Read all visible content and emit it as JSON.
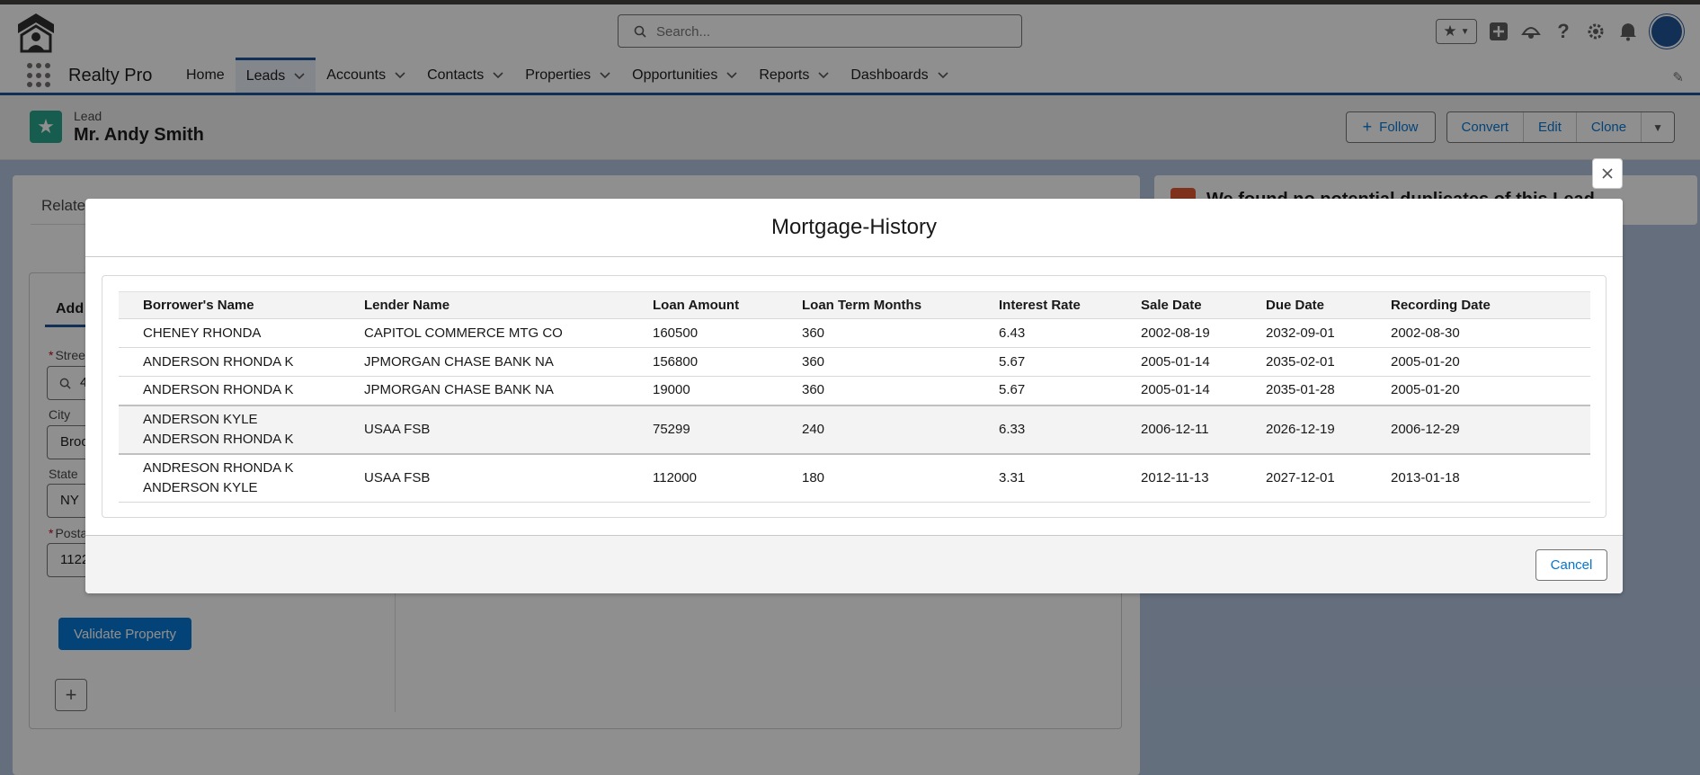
{
  "header": {
    "search_placeholder": "Search..."
  },
  "nav": {
    "app_name": "Realty Pro",
    "items": [
      {
        "label": "Home"
      },
      {
        "label": "Leads"
      },
      {
        "label": "Accounts"
      },
      {
        "label": "Contacts"
      },
      {
        "label": "Properties"
      },
      {
        "label": "Opportunities"
      },
      {
        "label": "Reports"
      },
      {
        "label": "Dashboards"
      }
    ]
  },
  "record": {
    "type": "Lead",
    "name": "Mr. Andy Smith",
    "actions": {
      "follow": "Follow",
      "convert": "Convert",
      "edit": "Edit",
      "clone": "Clone"
    }
  },
  "background": {
    "related_tab": "Relate",
    "address_tab": "Add",
    "street_label": "Street",
    "street_value": "4",
    "city_label": "City",
    "city_value": "Broo",
    "state_label": "State",
    "state_value": "NY",
    "postal_label": "Posta",
    "postal_value": "1122",
    "validate_button": "Validate Property",
    "duplicates_text": "We found no potential duplicates of this Lead."
  },
  "modal": {
    "title": "Mortgage-History",
    "columns": [
      "Borrower's Name",
      "Lender Name",
      "Loan Amount",
      "Loan Term Months",
      "Interest Rate",
      "Sale Date",
      "Due Date",
      "Recording Date"
    ],
    "rows": [
      {
        "borrower": [
          "CHENEY RHONDA"
        ],
        "lender": "CAPITOL COMMERCE MTG CO",
        "amount": "160500",
        "term": "360",
        "rate": "6.43",
        "sale": "2002-08-19",
        "due": "2032-09-01",
        "recording": "2002-08-30"
      },
      {
        "borrower": [
          "ANDERSON RHONDA K"
        ],
        "lender": "JPMORGAN CHASE BANK NA",
        "amount": "156800",
        "term": "360",
        "rate": "5.67",
        "sale": "2005-01-14",
        "due": "2035-02-01",
        "recording": "2005-01-20"
      },
      {
        "borrower": [
          "ANDERSON RHONDA K"
        ],
        "lender": "JPMORGAN CHASE BANK NA",
        "amount": "19000",
        "term": "360",
        "rate": "5.67",
        "sale": "2005-01-14",
        "due": "2035-01-28",
        "recording": "2005-01-20"
      },
      {
        "borrower": [
          "ANDERSON KYLE",
          "ANDERSON RHONDA K"
        ],
        "lender": "USAA FSB",
        "amount": "75299",
        "term": "240",
        "rate": "6.33",
        "sale": "2006-12-11",
        "due": "2026-12-19",
        "recording": "2006-12-29"
      },
      {
        "borrower": [
          "ANDRESON RHONDA K",
          "ANDERSON KYLE"
        ],
        "lender": "USAA FSB",
        "amount": "112000",
        "term": "180",
        "rate": "3.31",
        "sale": "2012-11-13",
        "due": "2027-12-01",
        "recording": "2013-01-18"
      }
    ],
    "cancel_label": "Cancel"
  }
}
